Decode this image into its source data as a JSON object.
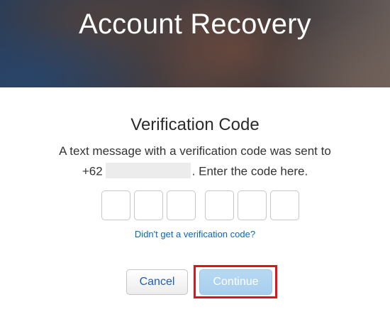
{
  "banner": {
    "title": "Account Recovery"
  },
  "verification": {
    "heading": "Verification Code",
    "message_line1": "A text message with a verification code was sent to",
    "phone_prefix": "+62",
    "message_line2_suffix": ". Enter the code here.",
    "code_digits": [
      "",
      "",
      "",
      "",
      "",
      ""
    ],
    "resend_link": "Didn't get a verification code?"
  },
  "buttons": {
    "cancel_label": "Cancel",
    "continue_label": "Continue"
  },
  "colors": {
    "link": "#0a64c8",
    "continue_bg": "#b7d9f3",
    "highlight_frame": "#e0141b"
  }
}
